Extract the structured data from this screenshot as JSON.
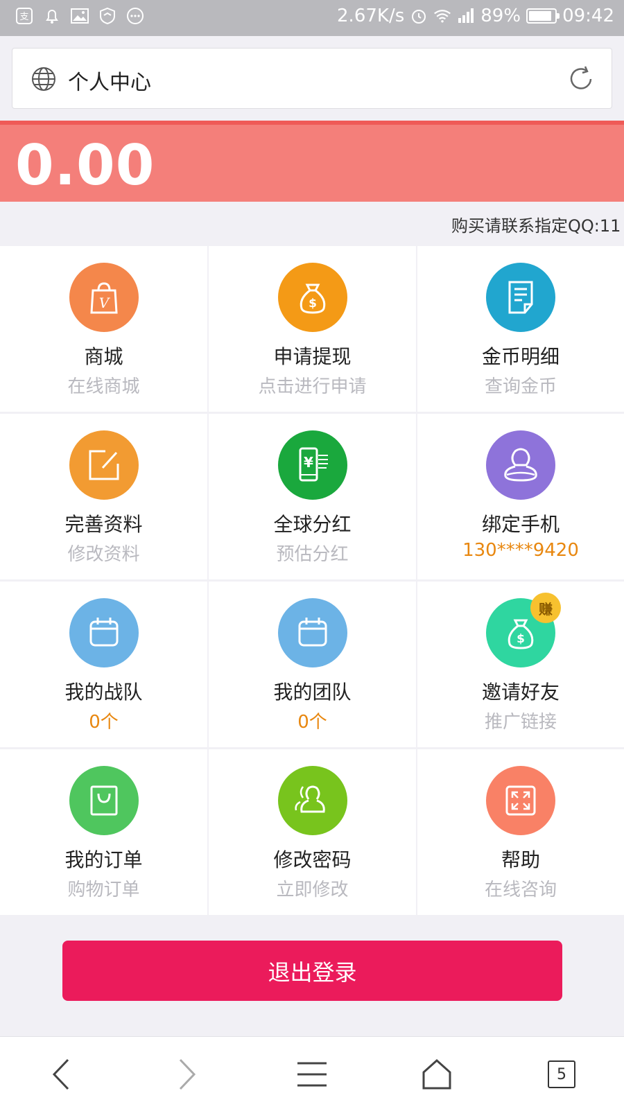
{
  "status_bar": {
    "speed": "2.67K/s",
    "battery": "89%",
    "battery_level": 0.89,
    "time": "09:42",
    "icons": [
      "alipay-icon",
      "notification-icon",
      "image-icon",
      "shield-icon",
      "more-icon",
      "alarm-icon",
      "wifi-icon",
      "signal-icon"
    ]
  },
  "address_bar": {
    "title": "个人中心",
    "globe_icon": "globe-icon",
    "reload_icon": "reload-icon"
  },
  "balance": {
    "value": "0.00",
    "color": "#f47f7a"
  },
  "notice": {
    "text": "购买请联系指定QQ:11"
  },
  "grid": [
    {
      "title": "商城",
      "sub": "在线商城",
      "icon": "shopping-bag-icon",
      "color": "#f4874b",
      "accent": false
    },
    {
      "title": "申请提现",
      "sub": "点击进行申请",
      "icon": "money-bag-icon",
      "color": "#f49a16",
      "accent": false
    },
    {
      "title": "金币明细",
      "sub": "查询金币",
      "icon": "document-icon",
      "color": "#21a6cf",
      "accent": false
    },
    {
      "title": "完善资料",
      "sub": "修改资料",
      "icon": "edit-icon",
      "color": "#f29b32",
      "accent": false
    },
    {
      "title": "全球分红",
      "sub": "预估分红",
      "icon": "yuan-phone-icon",
      "color": "#1aa83d",
      "accent": false
    },
    {
      "title": "绑定手机",
      "sub": "130****9420",
      "icon": "user-icon",
      "color": "#8e73da",
      "accent": true
    },
    {
      "title": "我的战队",
      "sub": "0个",
      "icon": "calendar-icon",
      "color": "#6cb3e6",
      "accent": true
    },
    {
      "title": "我的团队",
      "sub": "0个",
      "icon": "calendar-icon",
      "color": "#6cb3e6",
      "accent": true
    },
    {
      "title": "邀请好友",
      "sub": "推广链接",
      "icon": "money-bag-icon",
      "color": "#2fd6a0",
      "accent": false,
      "badge": "赚"
    },
    {
      "title": "我的订单",
      "sub": "购物订单",
      "icon": "bag-icon",
      "color": "#4fc65e",
      "accent": false
    },
    {
      "title": "修改密码",
      "sub": "立即修改",
      "icon": "users-icon",
      "color": "#78c41d",
      "accent": false
    },
    {
      "title": "帮助",
      "sub": "在线咨询",
      "icon": "expand-icon",
      "color": "#f98166",
      "accent": false
    }
  ],
  "logout": {
    "label": "退出登录",
    "color": "#eb1b5b"
  },
  "bottom_nav": {
    "tabs_count": "5",
    "icons": [
      "back-icon",
      "forward-icon",
      "menu-icon",
      "home-icon",
      "tabs-icon"
    ]
  }
}
